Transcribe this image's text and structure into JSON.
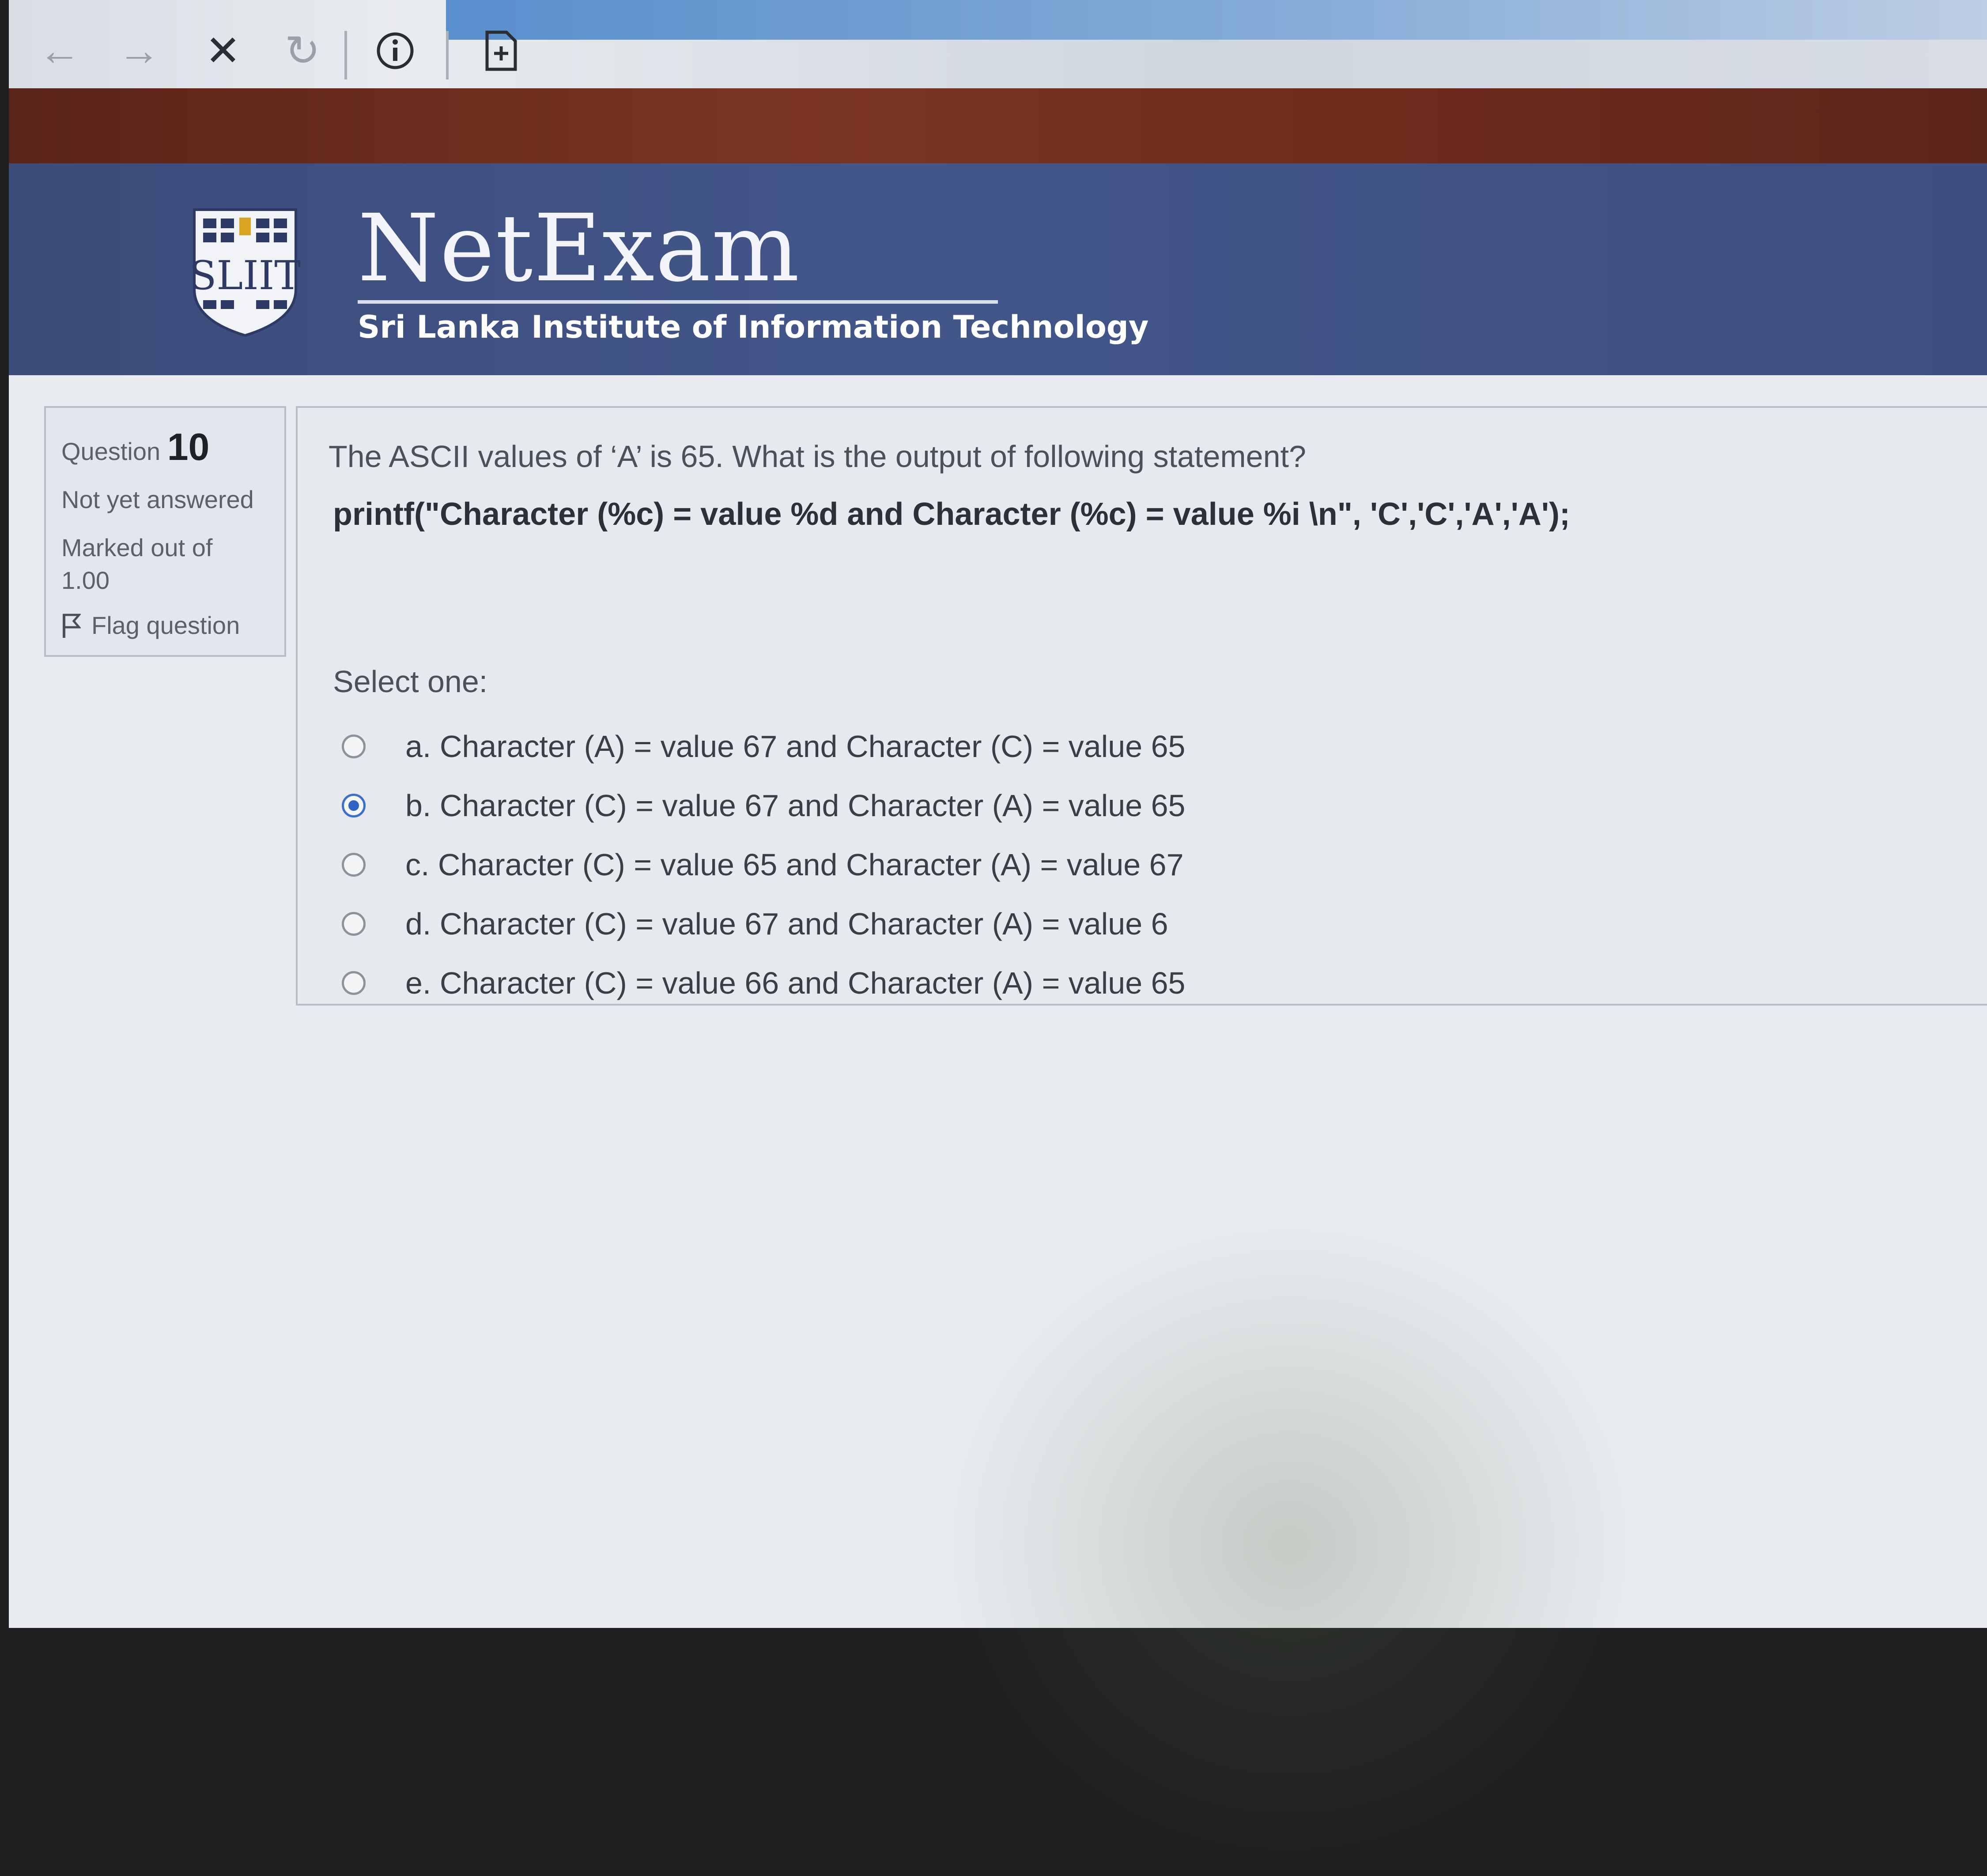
{
  "browser": {
    "icons": [
      "back-arrow-icon",
      "forward-arrow-icon",
      "close-icon",
      "reload-icon",
      "info-icon",
      "page-plus-icon"
    ]
  },
  "header": {
    "logo_text": "SLIIT",
    "title": "NetExam",
    "subtitle": "Sri Lanka Institute of Information Technology"
  },
  "question_info": {
    "label": "Question",
    "number": "10",
    "state": "Not yet answered",
    "marked_line1": "Marked out of",
    "marked_line2": "1.00",
    "flag_label": "Flag question"
  },
  "question": {
    "text": "The ASCII values of ‘A’ is 65. What is the output of following statement?",
    "code": "printf(\"Character (%c) = value %d and Character (%c) = value %i \\n\", 'C','C','A','A');",
    "select_label": "Select one:",
    "options": [
      {
        "label": "a. Character (A) = value 67 and Character (C) = value 65",
        "selected": false
      },
      {
        "label": "b. Character (C) = value 67 and Character (A) = value 65",
        "selected": true
      },
      {
        "label": "c. Character (C) = value 65 and Character (A) = value 67",
        "selected": false
      },
      {
        "label": "d. Character (C) = value 67 and Character (A) = value 6",
        "selected": false
      },
      {
        "label": "e. Character (C) = value 66 and Character (A) = value 65",
        "selected": false
      }
    ]
  },
  "colors": {
    "header_bg": "#43568a",
    "accent_radio": "#2f63c4",
    "top_strip": "#7b3522"
  }
}
